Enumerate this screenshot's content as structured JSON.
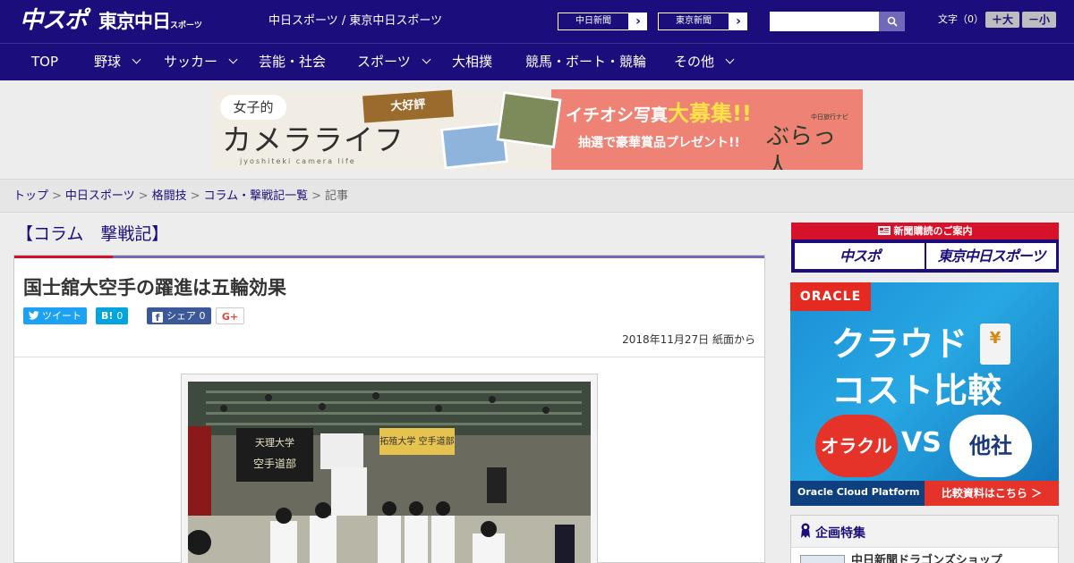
{
  "header": {
    "logo_chuspo": "中スポ",
    "logo_tokyo": "東京中日",
    "logo_tokyo_small": "スポーツ",
    "site_name": "中日スポーツ / 東京中日スポーツ",
    "ext_links": [
      {
        "label": "中日新聞"
      },
      {
        "label": "東京新聞"
      }
    ],
    "search": {
      "placeholder": "",
      "value": ""
    },
    "font_size_label": "文字（0）",
    "font_plus": "＋大",
    "font_minus": "－小"
  },
  "nav": {
    "items": [
      {
        "label": "TOP",
        "has_dropdown": false
      },
      {
        "label": "野球",
        "has_dropdown": true
      },
      {
        "label": "サッカー",
        "has_dropdown": true
      },
      {
        "label": "芸能・社会",
        "has_dropdown": false
      },
      {
        "label": "スポーツ",
        "has_dropdown": true
      },
      {
        "label": "大相撲",
        "has_dropdown": false
      },
      {
        "label": "競馬・ボート・競輪",
        "has_dropdown": false
      },
      {
        "label": "その他",
        "has_dropdown": true
      }
    ]
  },
  "banner": {
    "joshi": "女子的",
    "camera_life": "カメラライフ",
    "sub": "jyoshiteki camera life",
    "daikohyo": "大好評",
    "ichioshi_pre": "イチオシ写真",
    "ichioshi_big": "大募集!!",
    "prize": "抽選で豪華賞品プレゼント!!",
    "logo_small": "中日旅行ナビ",
    "logo": "ぶらっ人"
  },
  "breadcrumb": {
    "items": [
      "トップ",
      "中日スポーツ",
      "格闘技",
      "コラム・撃戦記一覧"
    ],
    "current": "記事",
    "separator": ">"
  },
  "article": {
    "column_title": "【コラム　撃戦記】",
    "title": "国士舘大空手の躍進は五輪効果",
    "share": {
      "tweet": "ツイート",
      "hatena_icon": "B!",
      "hatena_count": "0",
      "fb_label": "シェア",
      "fb_count": "0",
      "gplus": "G+"
    },
    "date": "2018年11月27日 紙面から",
    "photo_banners": [
      "天理大学 空手道部",
      "拓殖大学 空手道部"
    ]
  },
  "sidebar": {
    "subscription_header": "新聞購読のご案内",
    "subscription_boxes": [
      "中スポ",
      "東京中日スポーツ"
    ],
    "ad": {
      "brand": "ORACLE",
      "line1": "クラウド",
      "line2": "コスト比較",
      "doc_symbol": "¥",
      "left_circle": "オラクル",
      "vs": "VS",
      "right_circle": "他社",
      "footer_left": "Oracle Cloud Platform",
      "footer_right": "比較資料はこちら ＞"
    },
    "kikaku": {
      "title": "企画特集",
      "first_item": "中日新聞ドラゴンズショップ"
    }
  },
  "colors": {
    "brand": "#1b0e7c",
    "accent_red": "#d6122b",
    "accent_purple": "#6f69b8",
    "twitter": "#1da1f2",
    "hatena": "#00a4de",
    "facebook": "#3b5998"
  }
}
